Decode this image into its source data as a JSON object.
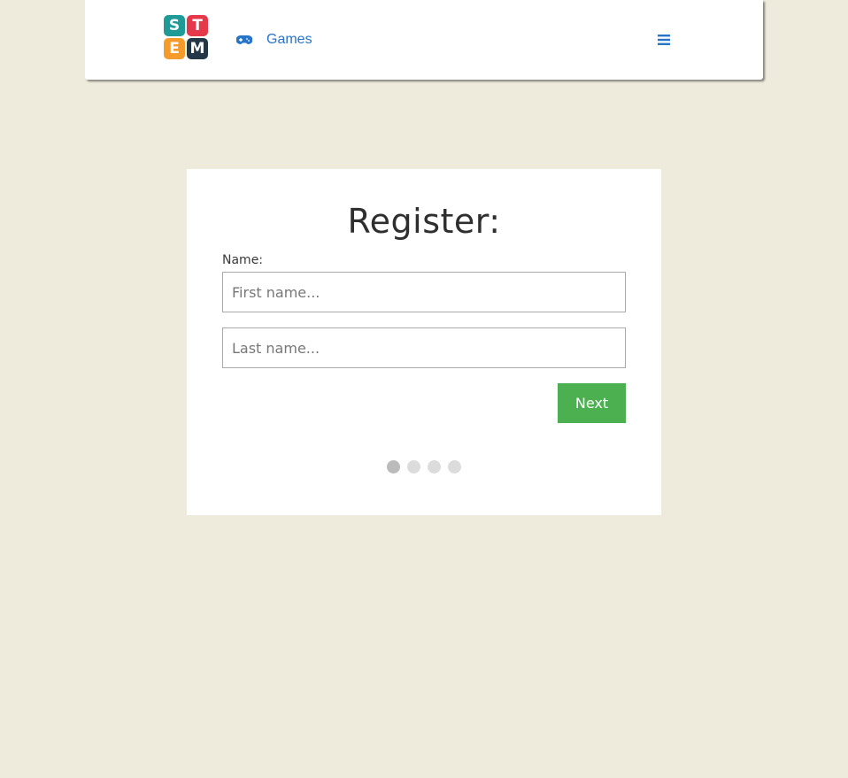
{
  "logo": {
    "tiles": [
      {
        "letter": "S",
        "color": "#1e9a97"
      },
      {
        "letter": "T",
        "color": "#e5384a"
      },
      {
        "letter": "E",
        "color": "#f59b2b"
      },
      {
        "letter": "M",
        "color": "#243746"
      }
    ]
  },
  "nav": {
    "games_icon": "gamepad-icon",
    "games_label": "Games",
    "menu_icon": "hamburger-menu-icon",
    "link_color": "#2874c8"
  },
  "form": {
    "title": "Register:",
    "name_label": "Name:",
    "first_name_placeholder": "First name...",
    "first_name_value": "",
    "last_name_placeholder": "Last name...",
    "last_name_value": "",
    "next_label": "Next",
    "next_color": "#4caf50"
  },
  "steps": {
    "total": 4,
    "current": 1
  }
}
